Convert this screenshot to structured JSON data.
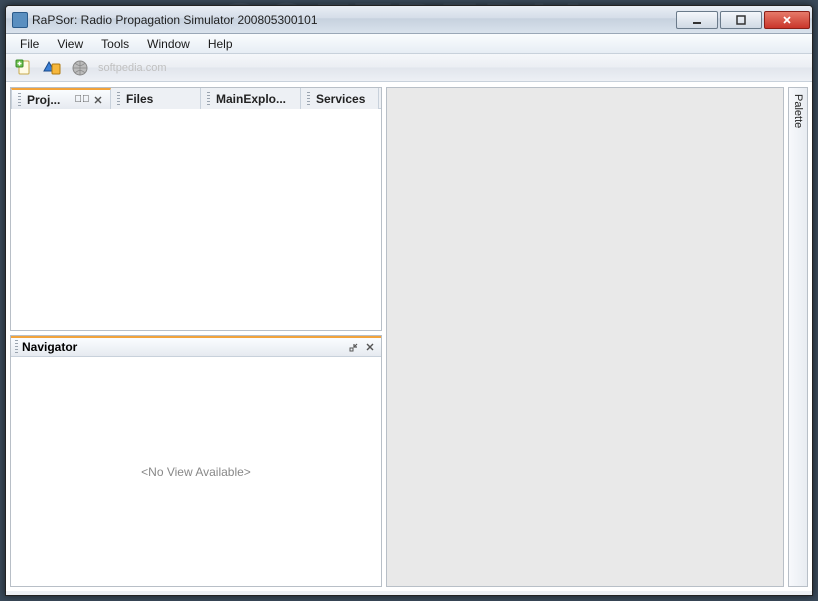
{
  "window": {
    "title": "RaPSor: Radio Propagation Simulator 200805300101"
  },
  "menu": {
    "file": "File",
    "view": "View",
    "tools": "Tools",
    "window": "Window",
    "help": "Help"
  },
  "toolbar": {
    "watermark": "softpedia.com"
  },
  "tabs": {
    "projects": "Proj...",
    "files": "Files",
    "main_explorer": "MainExplo...",
    "services": "Services"
  },
  "navigator": {
    "title": "Navigator",
    "empty": "<No View Available>"
  },
  "palette": {
    "label": "Palette"
  }
}
